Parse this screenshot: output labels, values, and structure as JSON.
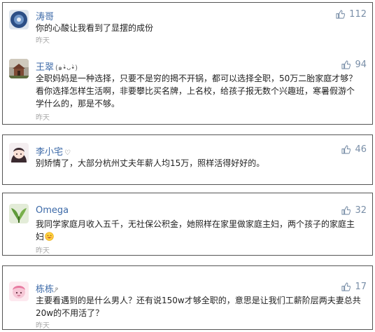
{
  "comments": [
    {
      "name": "涛哥",
      "name_glyph": "",
      "likes": "112",
      "text": "你的心酸让我看到了显摆的成份",
      "time": "昨天",
      "avatar": "blue-circle-avatar"
    },
    {
      "name": "王翠",
      "name_glyph": "(๑•̀ᴗ•̀)",
      "likes": "94",
      "text": "全职妈妈是一种选择，只要不是穷的揭不开锅，都可以选择全职，50万二胎家庭才够？看你选择怎样生活啊，非要攀比买名牌，上名校，给孩子报无数个兴趣班，寒暑假游个学什么的，那是不够。",
      "time": "昨天",
      "avatar": "house-landscape-avatar"
    },
    {
      "name": "李小宅",
      "name_glyph": "♡",
      "likes": "46",
      "text": "别矫情了，大部分杭州丈夫年薪人均15万，照样活得好好的。",
      "time": "",
      "avatar": "anime-girl-avatar"
    },
    {
      "name": "Omega",
      "name_glyph": "",
      "likes": "32",
      "text": "我同学家庭月收入五千，无社保公积金，她照样在家里做家庭主妇，两个孩子的家庭主妇",
      "time": "昨天",
      "avatar": "green-plant-avatar"
    },
    {
      "name": "栋栋",
      "name_glyph": "ⁿ̷",
      "likes": "17",
      "text": "主要看遇到的是什么男人？还有说150w才够全职的，意思是让我们工薪阶层两夫妻总共20w的不用活了？",
      "time": "昨天",
      "avatar": "pink-character-avatar"
    }
  ],
  "colors": {
    "name": "#3d6aa8",
    "like": "#7a8fa8",
    "text": "#222222",
    "time": "#aaaaaa",
    "card_border": "#555555"
  }
}
